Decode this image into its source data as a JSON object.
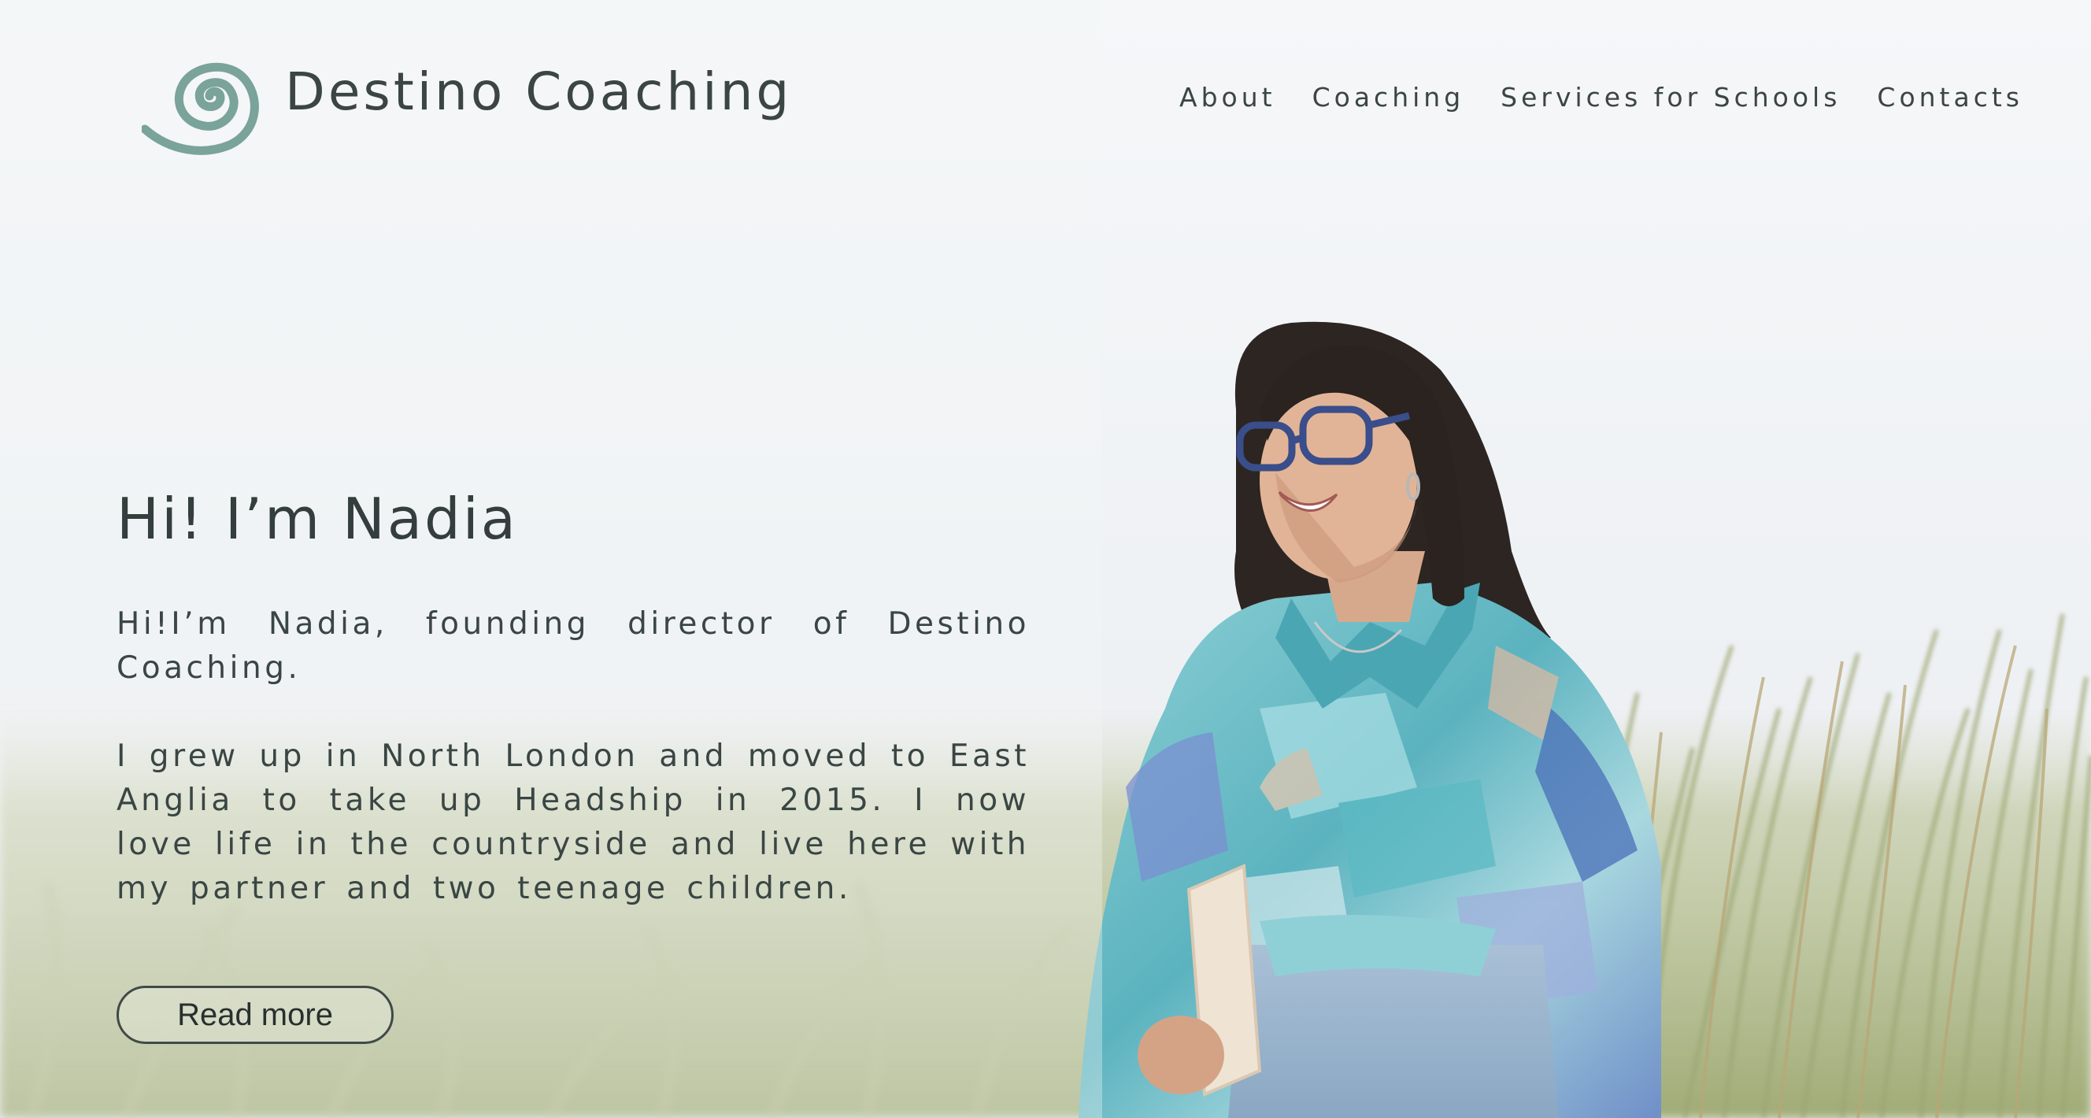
{
  "header": {
    "brand_name": "Destino Coaching",
    "logo_icon": "spiral-logo-icon",
    "nav": [
      {
        "label": "About"
      },
      {
        "label": "Coaching"
      },
      {
        "label": "Services for Schools"
      },
      {
        "label": "Contacts"
      }
    ]
  },
  "hero": {
    "title": "Hi! I’m Nadia",
    "intro": "Hi!I’m Nadia, founding director of Destino Coaching.",
    "story": "I grew up in North London and moved to East Anglia to take up Headship in 2015. I now love life in the countryside and live here with my partner and two teenage children.",
    "read_more_label": "Read more",
    "background_image": "woman-in-dune-grass-photo"
  },
  "colors": {
    "brand_teal": "#7aa39a",
    "text_dark": "#3a4644",
    "sky": "#f3f5f7",
    "grass": "#a3ad7a",
    "shirt_turquoise": "#5bb3bf"
  }
}
